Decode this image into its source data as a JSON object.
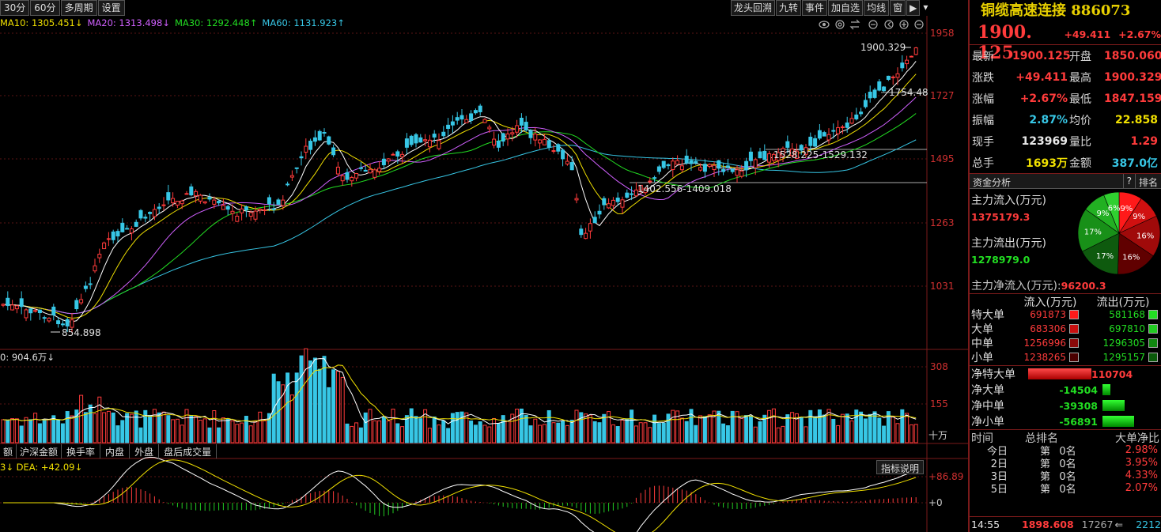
{
  "toolbar": {
    "left": [
      "30分",
      "60分",
      "多周期",
      "设置"
    ],
    "right": [
      "龙头回溯",
      "九转",
      "事件",
      "加自选",
      "均线",
      "窗",
      "▶",
      "▾"
    ]
  },
  "ma_legend": [
    {
      "text": "MA10: 1305.451↓",
      "color": "#f0e000"
    },
    {
      "text": "MA20: 1313.498↓",
      "color": "#d060ff"
    },
    {
      "text": "MA30: 1292.448↑",
      "color": "#22dd22"
    },
    {
      "text": "MA60: 1131.923↑",
      "color": "#37c7e6"
    }
  ],
  "price_axis": [
    "1958",
    "1727",
    "1495",
    "1263",
    "1031"
  ],
  "price_annotations": {
    "high": "1900.329",
    "a1": "1754.48",
    "a2": "1528.225-1529.132",
    "a3": "1402.556-1409.018",
    "low": "854.898"
  },
  "volume": {
    "legend": "0: 904.6万↓",
    "axis": [
      "308",
      "155"
    ],
    "unit": "十万"
  },
  "indicator_tabs": [
    "额",
    "沪深金额",
    "换手率",
    "内盘",
    "外盘",
    "盘后成交量"
  ],
  "macd": {
    "legend": "3↓ DEA: +42.09↓",
    "axis": [
      "+86.89",
      "+0"
    ],
    "help": "指标说明"
  },
  "stock": {
    "name": "铜缆高速连接",
    "code": "886073",
    "price": "1900. 125",
    "change": "+49.411",
    "change_pct": "+2.67%"
  },
  "quote": [
    {
      "l1": "最新",
      "v1": "1900.125",
      "c1": "red",
      "l2": "开盘",
      "v2": "1850.060",
      "c2": "red"
    },
    {
      "l1": "涨跌",
      "v1": "+49.411",
      "c1": "red",
      "l2": "最高",
      "v2": "1900.329",
      "c2": "red"
    },
    {
      "l1": "涨幅",
      "v1": "+2.67%",
      "c1": "red",
      "l2": "最低",
      "v2": "1847.159",
      "c2": "red"
    },
    {
      "l1": "振幅",
      "v1": "2.87%",
      "c1": "cyan",
      "l2": "均价",
      "v2": "22.858",
      "c2": "yellow"
    },
    {
      "l1": "现手",
      "v1": "123969",
      "c1": "white",
      "l2": "量比",
      "v2": "1.29",
      "c2": "red"
    },
    {
      "l1": "总手",
      "v1": "1693万",
      "c1": "yellow",
      "l2": "金额",
      "v2": "387.0亿",
      "c2": "cyan"
    }
  ],
  "fund": {
    "tab": "资金分析",
    "q": "?",
    "rank": "排名",
    "in_label": "主力流入(万元)",
    "in_val": "1375179.3",
    "out_label": "主力流出(万元)",
    "out_val": "1278979.0",
    "net_label": "主力净流入(万元):",
    "net_val": "96200.3",
    "pie": [
      {
        "label": "9%",
        "value": 9,
        "color": "#ff1a1a"
      },
      {
        "label": "9%",
        "value": 9,
        "color": "#d01010"
      },
      {
        "label": "16%",
        "value": 16,
        "color": "#a00a0a"
      },
      {
        "label": "16%",
        "value": 16,
        "color": "#600000"
      },
      {
        "label": "17%",
        "value": 17,
        "color": "#0e5a0e"
      },
      {
        "label": "17%",
        "value": 17,
        "color": "#189018"
      },
      {
        "label": "9%",
        "value": 9,
        "color": "#22b022"
      },
      {
        "label": "6%",
        "value": 6,
        "color": "#30d030"
      }
    ],
    "cols": [
      "流入(万元)",
      "流出(万元)"
    ],
    "rows": [
      {
        "label": "特大单",
        "in": "691873",
        "out": "581168",
        "inc": "#ff1a1a",
        "outc": "#22dd22"
      },
      {
        "label": "大单",
        "in": "683306",
        "out": "697810",
        "inc": "#c81010",
        "outc": "#22cc22"
      },
      {
        "label": "中单",
        "in": "1256996",
        "out": "1296305",
        "inc": "#8a0a0a",
        "outc": "#118811"
      },
      {
        "label": "小单",
        "in": "1238265",
        "out": "1295157",
        "inc": "#4a0000",
        "outc": "#0a5a0a"
      }
    ],
    "net": [
      {
        "label": "净特大单",
        "val": "110704",
        "color": "red",
        "w": 80
      },
      {
        "label": "净大单",
        "val": "-14504",
        "color": "green",
        "w": 10
      },
      {
        "label": "净中单",
        "val": "-39308",
        "color": "green",
        "w": 28
      },
      {
        "label": "净小单",
        "val": "-56891",
        "color": "green",
        "w": 40
      }
    ]
  },
  "rank": {
    "head": [
      "时间",
      "总排名",
      "大单净比"
    ],
    "rows": [
      {
        "day": "今日",
        "pos": "第",
        "num": "0名",
        "pct": "2.98%"
      },
      {
        "day": "2日",
        "pos": "第",
        "num": "0名",
        "pct": "3.95%"
      },
      {
        "day": "3日",
        "pos": "第",
        "num": "0名",
        "pct": "4.33%"
      },
      {
        "day": "5日",
        "pos": "第",
        "num": "0名",
        "pct": "2.07%"
      }
    ]
  },
  "status": {
    "time": "14:55",
    "price": "1898.608",
    "vol": "17267",
    "arrow": "⇐",
    "vol2": "2212"
  }
}
